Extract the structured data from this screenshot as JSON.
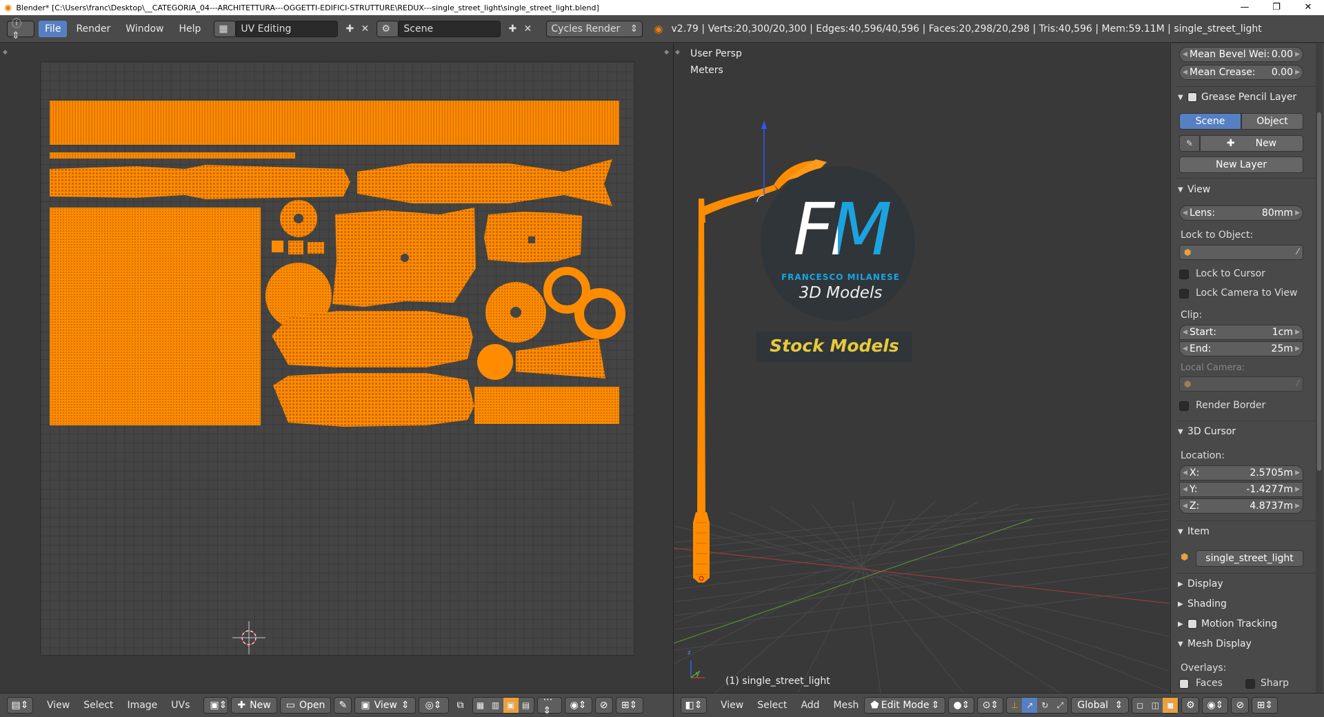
{
  "window": {
    "title": "Blender* [C:\\Users\\franc\\Desktop\\__CATEGORIA_04---ARCHITETTURA---OGGETTI-EDIFICI-STRUTTURE\\REDUX---single_street_light\\single_street_light.blend]",
    "controls": [
      "—",
      "❐",
      "✕"
    ]
  },
  "menubar": {
    "menus": [
      "File",
      "Render",
      "Window",
      "Help"
    ],
    "active_menu": "File",
    "layout": "UV Editing",
    "scene": "Scene",
    "engine": "Cycles Render",
    "stats": "v2.79 | Verts:20,300/20,300 | Edges:40,596/40,596 | Faces:20,298/20,298 | Tris:40,596 | Mem:59.11M | single_street_light"
  },
  "viewport": {
    "view_name": "User Persp",
    "units": "Meters",
    "object_label": "(1) single_street_light",
    "watermark": {
      "logo_letters": "FM",
      "author": "FRANCESCO MILANESE",
      "subtitle": "3D Models",
      "banner": "Stock Models"
    }
  },
  "npanel": {
    "mean_bevel_label": "Mean Bevel Wei:",
    "mean_bevel_value": "0.00",
    "mean_crease_label": "Mean Crease:",
    "mean_crease_value": "0.00",
    "grease_pencil_header": "Grease Pencil Layer",
    "tab_scene": "Scene",
    "tab_object": "Object",
    "new_label": "New",
    "new_layer_label": "New Layer",
    "view_header": "View",
    "lens_label": "Lens:",
    "lens_value": "80mm",
    "lock_to_object_label": "Lock to Object:",
    "lock_to_cursor": "Lock to Cursor",
    "lock_camera": "Lock Camera to View",
    "clip_label": "Clip:",
    "clip_start_label": "Start:",
    "clip_start_value": "1cm",
    "clip_end_label": "End:",
    "clip_end_value": "25m",
    "local_camera_label": "Local Camera:",
    "render_border": "Render Border",
    "cursor_header": "3D Cursor",
    "location_label": "Location:",
    "x_label": "X:",
    "x_value": "2.5705m",
    "y_label": "Y:",
    "y_value": "-1.4277m",
    "z_label": "Z:",
    "z_value": "4.8737m",
    "item_header": "Item",
    "item_name": "single_street_light",
    "display_header": "Display",
    "shading_header": "Shading",
    "motion_tracking_header": "Motion Tracking",
    "mesh_display_header": "Mesh Display",
    "overlays_label": "Overlays:",
    "faces_label": "Faces",
    "sharp_label": "Sharp"
  },
  "uv_footer": {
    "menus": [
      "View",
      "Select",
      "Image",
      "UVs"
    ],
    "new_label": "New",
    "open_label": "Open",
    "view_label": "View"
  },
  "vp_footer": {
    "menus": [
      "View",
      "Select",
      "Add",
      "Mesh"
    ],
    "mode": "Edit Mode",
    "orientation": "Global"
  },
  "colors": {
    "uv_orange": "#ff8c00",
    "accent_blue": "#5680c2",
    "background": "#393939"
  }
}
